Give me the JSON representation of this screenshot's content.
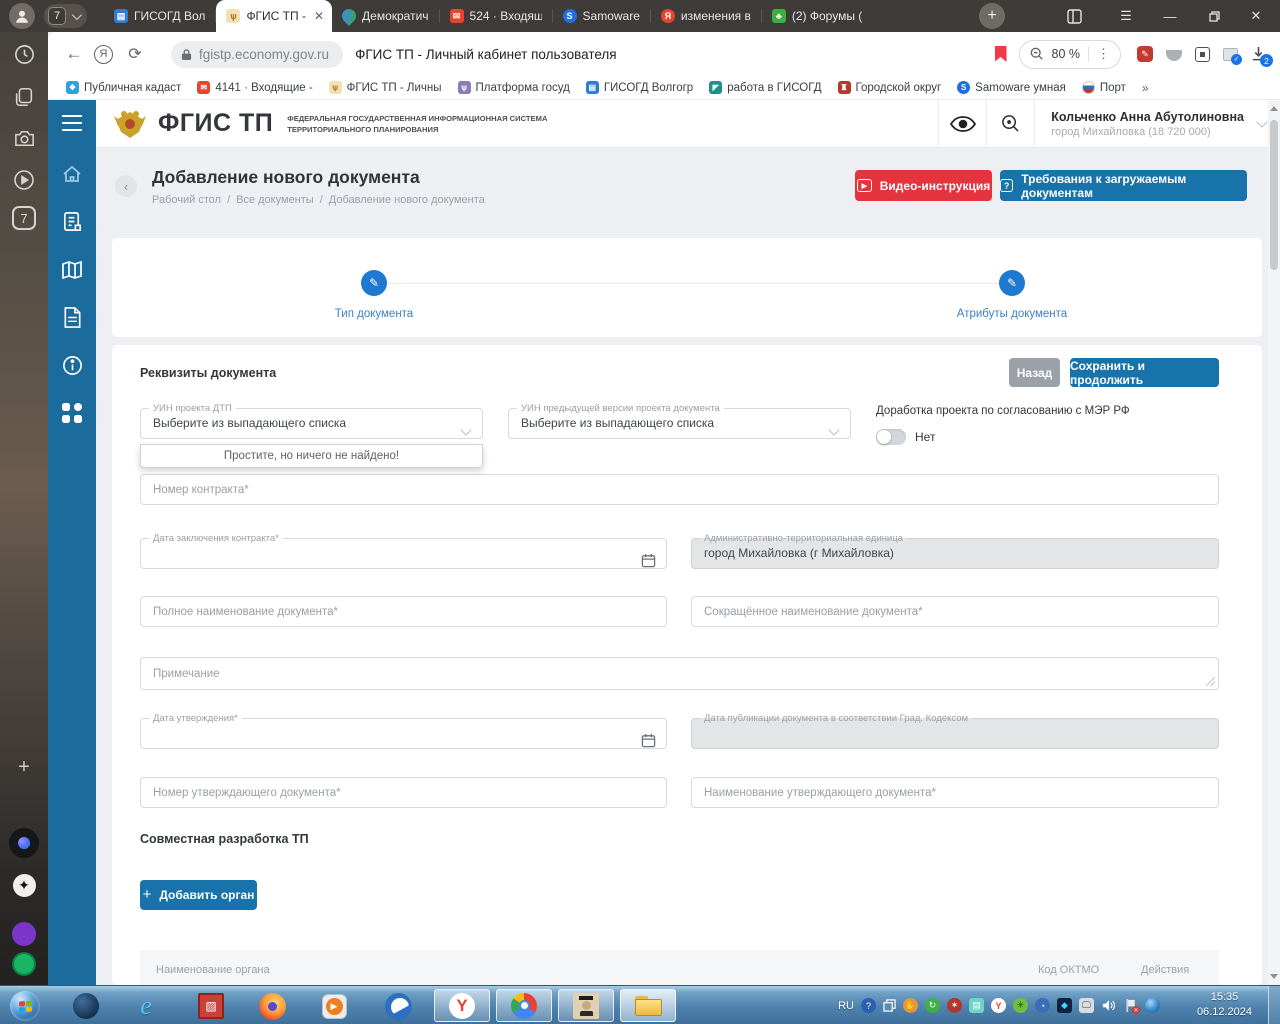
{
  "colors": {
    "accent_blue": "#1873ab",
    "accent_red": "#e5343e",
    "sidebar_blue": "#1b6b9c",
    "stepper_blue": "#1e79d2"
  },
  "browser": {
    "tab_group_badge": "7",
    "tabs": [
      {
        "label": "ГИСОГД Вол"
      },
      {
        "label": "ФГИС ТП -"
      },
      {
        "label": "Демократич"
      },
      {
        "label": "524 · Входящ"
      },
      {
        "label": "Samoware"
      },
      {
        "label": "изменения в"
      },
      {
        "label": "(2) Форумы ("
      }
    ],
    "url": "fgistp.economy.gov.ru",
    "page_title": "ФГИС ТП - Личный кабинет пользователя",
    "zoom_level": "80 %",
    "download_badge": "2",
    "sidebar_badge": "7",
    "bookmarks": [
      {
        "label": "Публичная кадаст"
      },
      {
        "label": "4141 · Входящие -"
      },
      {
        "label": "ФГИС ТП - Личны"
      },
      {
        "label": "Платформа госуд"
      },
      {
        "label": "ГИСОГД Волгогр"
      },
      {
        "label": "работа в ГИСОГД"
      },
      {
        "label": "Городской округ"
      },
      {
        "label": "Samoware умная"
      },
      {
        "label": "Порт"
      }
    ]
  },
  "app": {
    "logo_title": "ФГИС ТП",
    "logo_subtitle_line1": "ФЕДЕРАЛЬНАЯ ГОСУДАРСТВЕННАЯ ИНФОРМАЦИОННАЯ СИСТЕМА",
    "logo_subtitle_line2": "ТЕРРИТОРИАЛЬНОГО ПЛАНИРОВАНИЯ",
    "user": {
      "name": "Кольченко Анна Абутолиновна",
      "org": "город Михайловка (18 720 000)"
    },
    "page": {
      "title": "Добавление нового документа",
      "breadcrumb": [
        "Рабочий стол",
        "Все документы",
        "Добавление нового документа"
      ],
      "video_button": "Видео-инструкция",
      "requirements_button": "Требования к загружаемым документам"
    },
    "stepper": {
      "step1": "Тип документа",
      "step2": "Атрибуты документа"
    },
    "form": {
      "section_title": "Реквизиты документа",
      "back_button": "Назад",
      "save_button": "Сохранить и продолжить",
      "uin_dtp_label": "УИН проекта ДТП",
      "uin_dtp_value": "Выберите из выпадающего списка",
      "uin_dtp_dropdown_empty": "Простите, но ничего не найдено!",
      "uin_prev_label": "УИН предыдущей версии проекта документа",
      "uin_prev_value": "Выберите из выпадающего списка",
      "mer_label": "Доработка проекта по согласованию с МЭР РФ",
      "mer_toggle_value": "Нет",
      "contract_number_placeholder": "Номер контракта*",
      "contract_date_label": "Дата заключения контракта*",
      "admin_unit_label": "Административно-территориальная единица",
      "admin_unit_value": "город Михайловка (г Михайловка)",
      "full_name_placeholder": "Полное наименование документа*",
      "short_name_placeholder": "Сокращённое наименование документа*",
      "note_placeholder": "Примечание",
      "approval_date_label": "Дата утверждения*",
      "pub_date_label": "Дата публикации документа в соответствии Град. Кодексом",
      "approving_number_placeholder": "Номер утверждающего документа*",
      "approving_name_placeholder": "Наименование утверждающего документа*",
      "joint_section_title": "Совместная разработка ТП",
      "add_organ_button": "Добавить орган",
      "table_headers": [
        "Наименование органа",
        "Код ОКТМО",
        "Действия"
      ]
    }
  },
  "taskbar": {
    "language": "RU",
    "time": "15:35",
    "date": "06.12.2024"
  }
}
